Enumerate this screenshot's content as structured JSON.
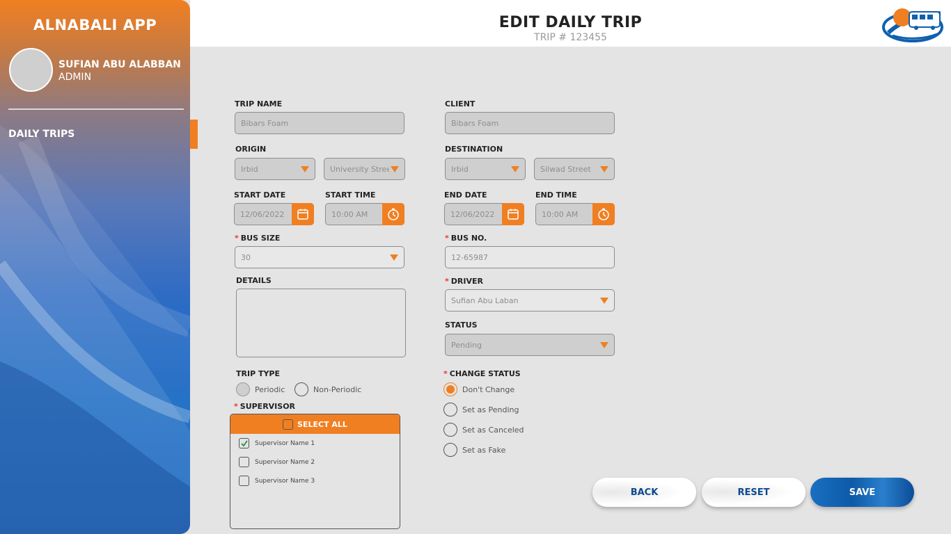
{
  "sidebar": {
    "app_title": "ALNABALI APP",
    "user_name": "SUFIAN ABU ALABBAN",
    "user_role": "ADMIN",
    "nav_items": [
      {
        "label": "DAILY TRIPS",
        "active": true
      }
    ]
  },
  "header": {
    "title": "EDIT DAILY TRIP",
    "subtitle": "TRIP # 123455"
  },
  "form": {
    "trip_name": {
      "label": "TRIP NAME",
      "value": "Bibars Foam"
    },
    "client": {
      "label": "CLIENT",
      "value": "Bibars Foam"
    },
    "origin": {
      "label": "ORIGIN",
      "city": "Irbid",
      "street": "University Street"
    },
    "destination": {
      "label": "DESTINATION",
      "city": "Irbid",
      "street": "Silwad Street"
    },
    "start_date": {
      "label": "START DATE",
      "value": "12/06/2022"
    },
    "start_time": {
      "label": "START TIME",
      "value": "10:00 AM"
    },
    "end_date": {
      "label": "END DATE",
      "value": "12/06/2022"
    },
    "end_time": {
      "label": "END TIME",
      "value": "10:00 AM"
    },
    "bus_size": {
      "label": "BUS SIZE",
      "value": "30",
      "required": true
    },
    "bus_no": {
      "label": "BUS NO.",
      "value": "12-65987",
      "required": true
    },
    "details": {
      "label": "DETAILS",
      "value": ""
    },
    "driver": {
      "label": "DRIVER",
      "value": "Sufian Abu Laban",
      "required": true
    },
    "status": {
      "label": "STATUS",
      "value": "Pending"
    },
    "trip_type": {
      "label": "TRIP TYPE",
      "options": [
        "Periodic",
        "Non-Periodic"
      ],
      "selected": "Periodic"
    },
    "change_status": {
      "label": "CHANGE STATUS",
      "required": true,
      "options": [
        "Don't Change",
        "Set as Pending",
        "Set as Canceled",
        "Set as Fake"
      ],
      "selected": "Don't Change"
    },
    "supervisor": {
      "label": "SUPERVISOR",
      "required": true,
      "select_all_label": "SELECT ALL",
      "items": [
        {
          "name": "Supervisor Name 1",
          "checked": true
        },
        {
          "name": "Supervisor Name 2",
          "checked": false
        },
        {
          "name": "Supervisor Name 3",
          "checked": false
        }
      ]
    }
  },
  "actions": {
    "back": "BACK",
    "reset": "RESET",
    "save": "SAVE"
  },
  "colors": {
    "accent": "#f07f22",
    "primary_blue": "#0d5aa8",
    "background": "#e4e4e4"
  },
  "req_mark": "*"
}
